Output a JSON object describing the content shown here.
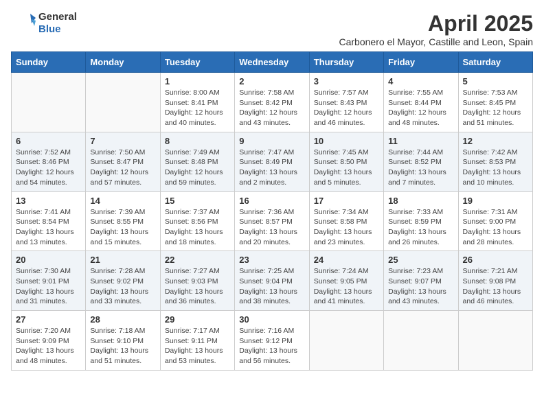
{
  "logo": {
    "general": "General",
    "blue": "Blue"
  },
  "title": "April 2025",
  "subtitle": "Carbonero el Mayor, Castille and Leon, Spain",
  "weekdays": [
    "Sunday",
    "Monday",
    "Tuesday",
    "Wednesday",
    "Thursday",
    "Friday",
    "Saturday"
  ],
  "weeks": [
    [
      {
        "day": "",
        "info": ""
      },
      {
        "day": "",
        "info": ""
      },
      {
        "day": "1",
        "info": "Sunrise: 8:00 AM\nSunset: 8:41 PM\nDaylight: 12 hours and 40 minutes."
      },
      {
        "day": "2",
        "info": "Sunrise: 7:58 AM\nSunset: 8:42 PM\nDaylight: 12 hours and 43 minutes."
      },
      {
        "day": "3",
        "info": "Sunrise: 7:57 AM\nSunset: 8:43 PM\nDaylight: 12 hours and 46 minutes."
      },
      {
        "day": "4",
        "info": "Sunrise: 7:55 AM\nSunset: 8:44 PM\nDaylight: 12 hours and 48 minutes."
      },
      {
        "day": "5",
        "info": "Sunrise: 7:53 AM\nSunset: 8:45 PM\nDaylight: 12 hours and 51 minutes."
      }
    ],
    [
      {
        "day": "6",
        "info": "Sunrise: 7:52 AM\nSunset: 8:46 PM\nDaylight: 12 hours and 54 minutes."
      },
      {
        "day": "7",
        "info": "Sunrise: 7:50 AM\nSunset: 8:47 PM\nDaylight: 12 hours and 57 minutes."
      },
      {
        "day": "8",
        "info": "Sunrise: 7:49 AM\nSunset: 8:48 PM\nDaylight: 12 hours and 59 minutes."
      },
      {
        "day": "9",
        "info": "Sunrise: 7:47 AM\nSunset: 8:49 PM\nDaylight: 13 hours and 2 minutes."
      },
      {
        "day": "10",
        "info": "Sunrise: 7:45 AM\nSunset: 8:50 PM\nDaylight: 13 hours and 5 minutes."
      },
      {
        "day": "11",
        "info": "Sunrise: 7:44 AM\nSunset: 8:52 PM\nDaylight: 13 hours and 7 minutes."
      },
      {
        "day": "12",
        "info": "Sunrise: 7:42 AM\nSunset: 8:53 PM\nDaylight: 13 hours and 10 minutes."
      }
    ],
    [
      {
        "day": "13",
        "info": "Sunrise: 7:41 AM\nSunset: 8:54 PM\nDaylight: 13 hours and 13 minutes."
      },
      {
        "day": "14",
        "info": "Sunrise: 7:39 AM\nSunset: 8:55 PM\nDaylight: 13 hours and 15 minutes."
      },
      {
        "day": "15",
        "info": "Sunrise: 7:37 AM\nSunset: 8:56 PM\nDaylight: 13 hours and 18 minutes."
      },
      {
        "day": "16",
        "info": "Sunrise: 7:36 AM\nSunset: 8:57 PM\nDaylight: 13 hours and 20 minutes."
      },
      {
        "day": "17",
        "info": "Sunrise: 7:34 AM\nSunset: 8:58 PM\nDaylight: 13 hours and 23 minutes."
      },
      {
        "day": "18",
        "info": "Sunrise: 7:33 AM\nSunset: 8:59 PM\nDaylight: 13 hours and 26 minutes."
      },
      {
        "day": "19",
        "info": "Sunrise: 7:31 AM\nSunset: 9:00 PM\nDaylight: 13 hours and 28 minutes."
      }
    ],
    [
      {
        "day": "20",
        "info": "Sunrise: 7:30 AM\nSunset: 9:01 PM\nDaylight: 13 hours and 31 minutes."
      },
      {
        "day": "21",
        "info": "Sunrise: 7:28 AM\nSunset: 9:02 PM\nDaylight: 13 hours and 33 minutes."
      },
      {
        "day": "22",
        "info": "Sunrise: 7:27 AM\nSunset: 9:03 PM\nDaylight: 13 hours and 36 minutes."
      },
      {
        "day": "23",
        "info": "Sunrise: 7:25 AM\nSunset: 9:04 PM\nDaylight: 13 hours and 38 minutes."
      },
      {
        "day": "24",
        "info": "Sunrise: 7:24 AM\nSunset: 9:05 PM\nDaylight: 13 hours and 41 minutes."
      },
      {
        "day": "25",
        "info": "Sunrise: 7:23 AM\nSunset: 9:07 PM\nDaylight: 13 hours and 43 minutes."
      },
      {
        "day": "26",
        "info": "Sunrise: 7:21 AM\nSunset: 9:08 PM\nDaylight: 13 hours and 46 minutes."
      }
    ],
    [
      {
        "day": "27",
        "info": "Sunrise: 7:20 AM\nSunset: 9:09 PM\nDaylight: 13 hours and 48 minutes."
      },
      {
        "day": "28",
        "info": "Sunrise: 7:18 AM\nSunset: 9:10 PM\nDaylight: 13 hours and 51 minutes."
      },
      {
        "day": "29",
        "info": "Sunrise: 7:17 AM\nSunset: 9:11 PM\nDaylight: 13 hours and 53 minutes."
      },
      {
        "day": "30",
        "info": "Sunrise: 7:16 AM\nSunset: 9:12 PM\nDaylight: 13 hours and 56 minutes."
      },
      {
        "day": "",
        "info": ""
      },
      {
        "day": "",
        "info": ""
      },
      {
        "day": "",
        "info": ""
      }
    ]
  ]
}
